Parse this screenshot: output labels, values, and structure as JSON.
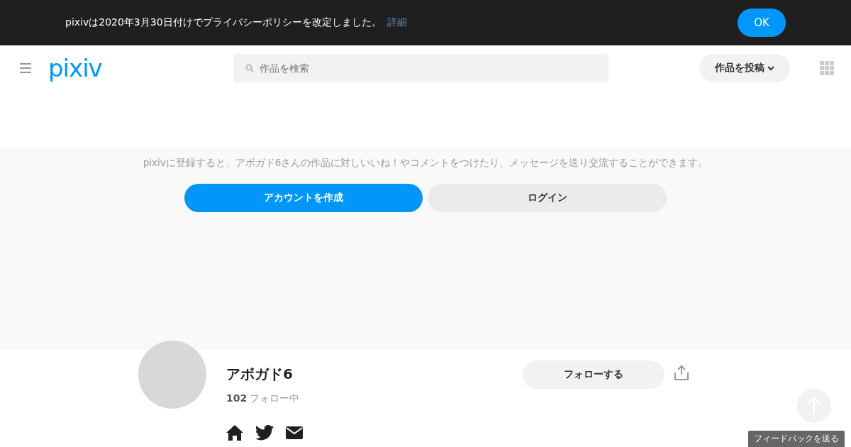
{
  "notice": {
    "message": "pixivは2020年3月30日付けでプライバシーポリシーを改定しました。",
    "link": "詳細",
    "button": "OK"
  },
  "header": {
    "logo": "pixiv",
    "search": {
      "placeholder": "作品を検索"
    },
    "post_button": "作品を投稿"
  },
  "signup": {
    "message": "pixivに登録すると、アボガド6さんの作品に対しいいね！やコメントをつけたり、メッセージを送り交流することができます。",
    "create_button": "アカウントを作成",
    "login_button": "ログイン"
  },
  "profile": {
    "name": "アボガド6",
    "following_count": "102",
    "following_label": "フォロー中",
    "follow_button": "フォローする"
  },
  "feedback": "フィードバックを送る"
}
